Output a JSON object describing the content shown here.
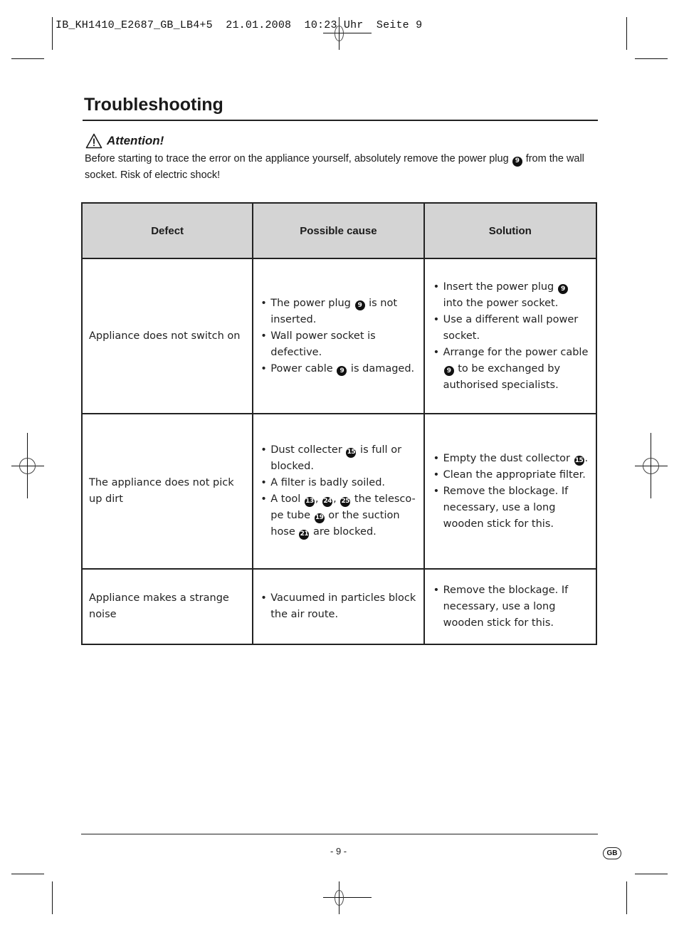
{
  "print_slug": "IB_KH1410_E2687_GB_LB4+5  21.01.2008  10:23 Uhr  Seite 9",
  "page_title": "Troubleshooting",
  "attention": {
    "icon": "warning-triangle-icon",
    "label": "Attention!",
    "text_before": "Before starting to trace the error on the appliance yourself, absolutely remove the power plug ",
    "ref": "9",
    "text_after": " from the wall socket. Risk of electric shock!"
  },
  "table": {
    "headers": [
      "Defect",
      "Possible cause",
      "Solution"
    ],
    "rows": [
      {
        "defect": "Appliance does not switch on",
        "causes": [
          [
            {
              "t": "The power plug "
            },
            {
              "ref": "9"
            },
            {
              "t": " is not inserted."
            }
          ],
          [
            {
              "t": "Wall power socket is defective."
            }
          ],
          [
            {
              "t": "Power cable "
            },
            {
              "ref": "9"
            },
            {
              "t": " is damaged."
            }
          ]
        ],
        "solutions": [
          [
            {
              "t": "Insert the power plug "
            },
            {
              "ref": "9"
            },
            {
              "t": " into the power socket."
            }
          ],
          [
            {
              "t": "Use a different wall power socket."
            }
          ],
          [
            {
              "t": "Arrange for the power cable "
            },
            {
              "ref": "9"
            },
            {
              "t": " to be exchanged by authorised specialists."
            }
          ]
        ]
      },
      {
        "defect": "The appliance does not pick up dirt",
        "causes": [
          [
            {
              "t": "Dust collecter "
            },
            {
              "ref": "15"
            },
            {
              "t": " is full or blocked."
            }
          ],
          [
            {
              "t": "A filter is badly soiled."
            }
          ],
          [
            {
              "t": "A tool "
            },
            {
              "ref": "13"
            },
            {
              "t": ", "
            },
            {
              "ref": "24"
            },
            {
              "t": ", "
            },
            {
              "ref": "25"
            },
            {
              "t": " the telesco-pe tube "
            },
            {
              "ref": "19"
            },
            {
              "t": " or the suction hose "
            },
            {
              "ref": "21"
            },
            {
              "t": " are blocked."
            }
          ]
        ],
        "solutions": [
          [
            {
              "t": "Empty the dust collector "
            },
            {
              "ref": "15"
            },
            {
              "t": "."
            }
          ],
          [
            {
              "t": "Clean the appropriate filter."
            }
          ],
          [
            {
              "t": "Remove the blockage. If necessary, use a long wooden stick for this."
            }
          ]
        ]
      },
      {
        "defect": "Appliance makes a strange noise",
        "causes": [
          [
            {
              "t": "Vacuumed in particles block the air route."
            }
          ]
        ],
        "solutions": [
          [
            {
              "t": "Remove the blockage. If necessary, use a long wooden stick for this."
            }
          ]
        ]
      }
    ]
  },
  "footer": {
    "page_number": "- 9 -",
    "language_badge": "GB"
  }
}
